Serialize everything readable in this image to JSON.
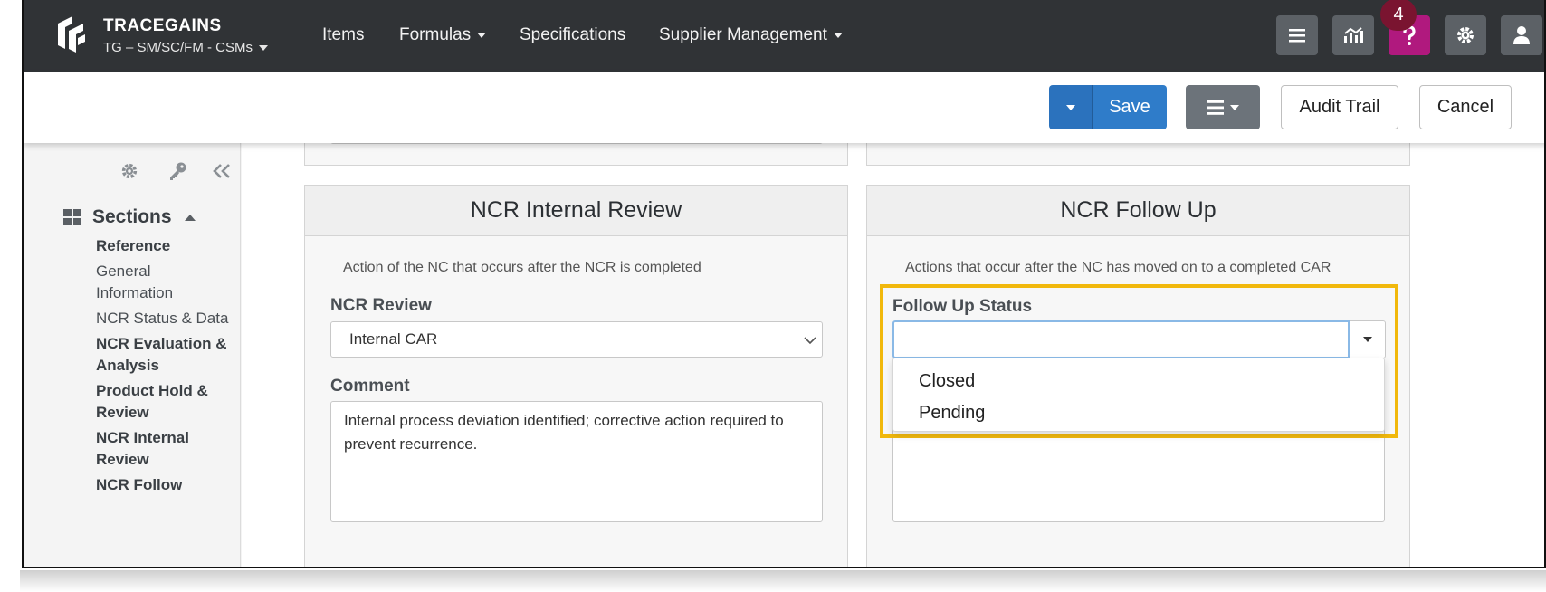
{
  "header": {
    "brand": "TRACEGAINS",
    "org": "TG – SM/SC/FM - CSMs",
    "nav": [
      {
        "label": "Items"
      },
      {
        "label": "Formulas",
        "has_caret": true
      },
      {
        "label": "Specifications"
      },
      {
        "label": "Supplier Management",
        "has_caret": true
      }
    ],
    "notification_count": "4"
  },
  "toolbar": {
    "save_label": "Save",
    "audit_label": "Audit Trail",
    "cancel_label": "Cancel"
  },
  "sidebar": {
    "sections_label": "Sections",
    "items": [
      {
        "label": "Reference",
        "bold": true
      },
      {
        "label": "General Information",
        "bold": false
      },
      {
        "label": "NCR Status & Data",
        "bold": false
      },
      {
        "label": "NCR Evaluation & Analysis",
        "bold": true
      },
      {
        "label": "Product Hold & Review",
        "bold": true
      },
      {
        "label": "NCR Internal Review",
        "bold": true
      },
      {
        "label": "NCR Follow",
        "bold": true
      }
    ]
  },
  "internal_review": {
    "title": "NCR Internal Review",
    "description": "Action of the NC that occurs after the NCR is completed",
    "review_label": "NCR Review",
    "review_value": "Internal CAR",
    "comment_label": "Comment",
    "comment_value": "Internal process deviation identified; corrective action required to prevent recurrence."
  },
  "follow_up": {
    "title": "NCR Follow Up",
    "description": "Actions that occur after the NC has moved on to a completed CAR",
    "status_label": "Follow Up Status",
    "status_value": "",
    "options": [
      "Closed",
      "Pending"
    ]
  },
  "colors": {
    "nav_bg": "#303336",
    "primary": "#2f7cc9",
    "help": "#b0197e",
    "highlight": "#f1b80c"
  }
}
